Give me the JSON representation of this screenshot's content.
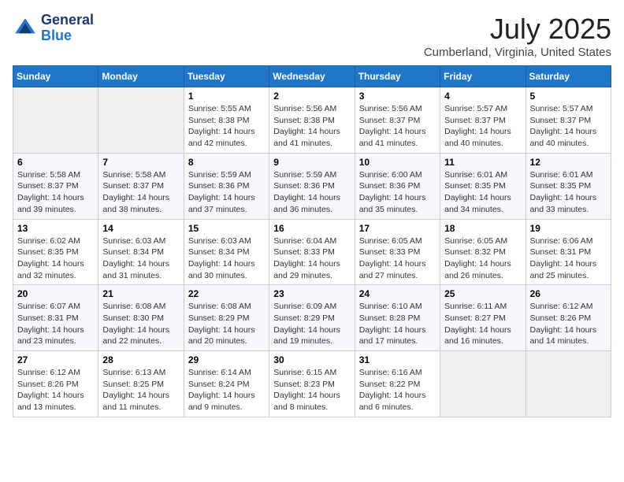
{
  "header": {
    "logo_line1": "General",
    "logo_line2": "Blue",
    "month": "July 2025",
    "location": "Cumberland, Virginia, United States"
  },
  "weekdays": [
    "Sunday",
    "Monday",
    "Tuesday",
    "Wednesday",
    "Thursday",
    "Friday",
    "Saturday"
  ],
  "weeks": [
    [
      {
        "day": "",
        "detail": ""
      },
      {
        "day": "",
        "detail": ""
      },
      {
        "day": "1",
        "detail": "Sunrise: 5:55 AM\nSunset: 8:38 PM\nDaylight: 14 hours and 42 minutes."
      },
      {
        "day": "2",
        "detail": "Sunrise: 5:56 AM\nSunset: 8:38 PM\nDaylight: 14 hours and 41 minutes."
      },
      {
        "day": "3",
        "detail": "Sunrise: 5:56 AM\nSunset: 8:37 PM\nDaylight: 14 hours and 41 minutes."
      },
      {
        "day": "4",
        "detail": "Sunrise: 5:57 AM\nSunset: 8:37 PM\nDaylight: 14 hours and 40 minutes."
      },
      {
        "day": "5",
        "detail": "Sunrise: 5:57 AM\nSunset: 8:37 PM\nDaylight: 14 hours and 40 minutes."
      }
    ],
    [
      {
        "day": "6",
        "detail": "Sunrise: 5:58 AM\nSunset: 8:37 PM\nDaylight: 14 hours and 39 minutes."
      },
      {
        "day": "7",
        "detail": "Sunrise: 5:58 AM\nSunset: 8:37 PM\nDaylight: 14 hours and 38 minutes."
      },
      {
        "day": "8",
        "detail": "Sunrise: 5:59 AM\nSunset: 8:36 PM\nDaylight: 14 hours and 37 minutes."
      },
      {
        "day": "9",
        "detail": "Sunrise: 5:59 AM\nSunset: 8:36 PM\nDaylight: 14 hours and 36 minutes."
      },
      {
        "day": "10",
        "detail": "Sunrise: 6:00 AM\nSunset: 8:36 PM\nDaylight: 14 hours and 35 minutes."
      },
      {
        "day": "11",
        "detail": "Sunrise: 6:01 AM\nSunset: 8:35 PM\nDaylight: 14 hours and 34 minutes."
      },
      {
        "day": "12",
        "detail": "Sunrise: 6:01 AM\nSunset: 8:35 PM\nDaylight: 14 hours and 33 minutes."
      }
    ],
    [
      {
        "day": "13",
        "detail": "Sunrise: 6:02 AM\nSunset: 8:35 PM\nDaylight: 14 hours and 32 minutes."
      },
      {
        "day": "14",
        "detail": "Sunrise: 6:03 AM\nSunset: 8:34 PM\nDaylight: 14 hours and 31 minutes."
      },
      {
        "day": "15",
        "detail": "Sunrise: 6:03 AM\nSunset: 8:34 PM\nDaylight: 14 hours and 30 minutes."
      },
      {
        "day": "16",
        "detail": "Sunrise: 6:04 AM\nSunset: 8:33 PM\nDaylight: 14 hours and 29 minutes."
      },
      {
        "day": "17",
        "detail": "Sunrise: 6:05 AM\nSunset: 8:33 PM\nDaylight: 14 hours and 27 minutes."
      },
      {
        "day": "18",
        "detail": "Sunrise: 6:05 AM\nSunset: 8:32 PM\nDaylight: 14 hours and 26 minutes."
      },
      {
        "day": "19",
        "detail": "Sunrise: 6:06 AM\nSunset: 8:31 PM\nDaylight: 14 hours and 25 minutes."
      }
    ],
    [
      {
        "day": "20",
        "detail": "Sunrise: 6:07 AM\nSunset: 8:31 PM\nDaylight: 14 hours and 23 minutes."
      },
      {
        "day": "21",
        "detail": "Sunrise: 6:08 AM\nSunset: 8:30 PM\nDaylight: 14 hours and 22 minutes."
      },
      {
        "day": "22",
        "detail": "Sunrise: 6:08 AM\nSunset: 8:29 PM\nDaylight: 14 hours and 20 minutes."
      },
      {
        "day": "23",
        "detail": "Sunrise: 6:09 AM\nSunset: 8:29 PM\nDaylight: 14 hours and 19 minutes."
      },
      {
        "day": "24",
        "detail": "Sunrise: 6:10 AM\nSunset: 8:28 PM\nDaylight: 14 hours and 17 minutes."
      },
      {
        "day": "25",
        "detail": "Sunrise: 6:11 AM\nSunset: 8:27 PM\nDaylight: 14 hours and 16 minutes."
      },
      {
        "day": "26",
        "detail": "Sunrise: 6:12 AM\nSunset: 8:26 PM\nDaylight: 14 hours and 14 minutes."
      }
    ],
    [
      {
        "day": "27",
        "detail": "Sunrise: 6:12 AM\nSunset: 8:26 PM\nDaylight: 14 hours and 13 minutes."
      },
      {
        "day": "28",
        "detail": "Sunrise: 6:13 AM\nSunset: 8:25 PM\nDaylight: 14 hours and 11 minutes."
      },
      {
        "day": "29",
        "detail": "Sunrise: 6:14 AM\nSunset: 8:24 PM\nDaylight: 14 hours and 9 minutes."
      },
      {
        "day": "30",
        "detail": "Sunrise: 6:15 AM\nSunset: 8:23 PM\nDaylight: 14 hours and 8 minutes."
      },
      {
        "day": "31",
        "detail": "Sunrise: 6:16 AM\nSunset: 8:22 PM\nDaylight: 14 hours and 6 minutes."
      },
      {
        "day": "",
        "detail": ""
      },
      {
        "day": "",
        "detail": ""
      }
    ]
  ]
}
